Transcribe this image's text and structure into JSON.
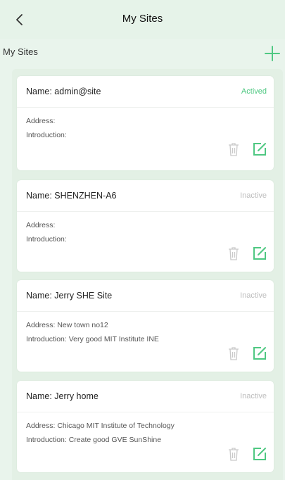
{
  "header": {
    "title": "My Sites"
  },
  "section": {
    "title": "My Sites"
  },
  "colors": {
    "accent": "#4fc882",
    "background": "#e9f4ec",
    "inactive": "#bdbdbd"
  },
  "icons": {
    "back": "chevron-left-icon",
    "add": "plus-icon",
    "delete": "trash-icon",
    "edit": "edit-icon"
  },
  "sites": [
    {
      "name": "Name: admin@site",
      "status": "Actived",
      "address": "Address:",
      "introduction": "Introduction:"
    },
    {
      "name": "Name: SHENZHEN-A6",
      "status": "Inactive",
      "address": "Address:",
      "introduction": "Introduction:"
    },
    {
      "name": "Name: Jerry SHE Site",
      "status": "Inactive",
      "address": "Address: New town no12",
      "introduction": "Introduction: Very good MIT Institute INE"
    },
    {
      "name": "Name: Jerry home",
      "status": "Inactive",
      "address": "Address: Chicago MIT Institute of Technology",
      "introduction": "Introduction: Create good GVE SunShine"
    }
  ]
}
